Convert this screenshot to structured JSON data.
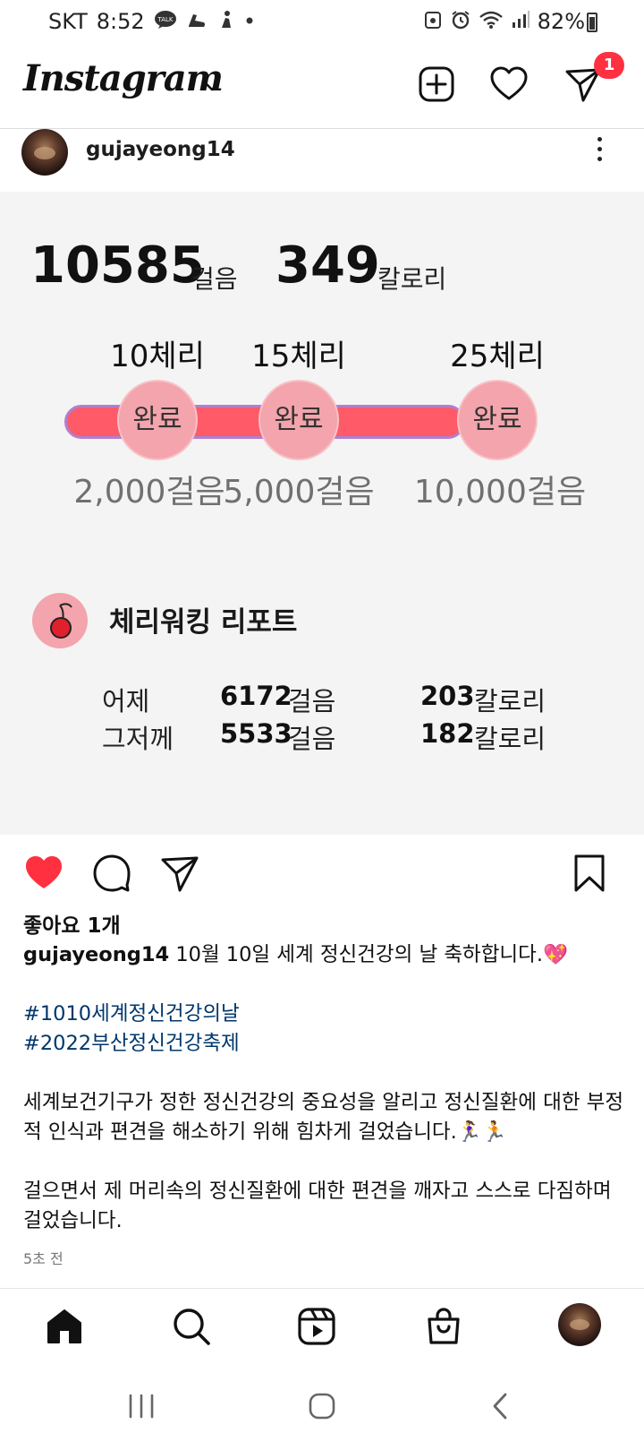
{
  "status_bar": {
    "carrier": "SKT",
    "time": "8:52",
    "talk_badge": "TALK",
    "battery": "82%"
  },
  "header": {
    "logo": "Instagram",
    "notification_count": "1"
  },
  "post": {
    "username": "gujayeong14",
    "image": {
      "steps_value": "10585",
      "steps_unit": "걸음",
      "calories_value": "349",
      "calories_unit": "칼로리",
      "stages": [
        {
          "cherries": "10체리",
          "status": "완료",
          "steps": "2,000걸음"
        },
        {
          "cherries": "15체리",
          "status": "완료",
          "steps": "5,000걸음"
        },
        {
          "cherries": "25체리",
          "status": "완료",
          "steps": "10,000걸음"
        }
      ],
      "report_title": "체리워킹 리포트",
      "report_rows": [
        {
          "day": "어제",
          "steps": "6172",
          "steps_unit": "걸음",
          "calories": "203",
          "calories_unit": "칼로리"
        },
        {
          "day": "그저께",
          "steps": "5533",
          "steps_unit": "걸음",
          "calories": "182",
          "calories_unit": "칼로리"
        }
      ]
    },
    "likes": "좋아요 1개",
    "caption": {
      "username": "gujayeong14",
      "first_line": "10월 10일 세계 정신건강의 날 축하합니다.💖",
      "hashtags": [
        "#1010세계정신건강의날",
        "#2022부산정신건강축제"
      ],
      "paragraph1": "세계보건기구가 정한 정신건강의 중요성을 알리고 정신질환에 대한 부정적 인식과 편견을 해소하기 위해 힘차게 걸었습니다.🏃‍♀️🏃",
      "paragraph2": "걸으면서 제 머리속의 정신질환에 대한 편견을 깨자고 스스로 다짐하며 걸었습니다."
    },
    "time_ago": "5초 전"
  },
  "colors": {
    "like_red": "#ff3040",
    "hashtag_blue": "#00376b",
    "track_red": "#ff5a68",
    "circle_pink": "#f4a4ac"
  },
  "icons": {
    "header": [
      "new-post-icon",
      "heart-icon",
      "direct-message-icon"
    ],
    "actions": [
      "like-heart-icon",
      "comment-icon",
      "share-icon",
      "save-bookmark-icon"
    ],
    "bottom_nav": [
      "home-icon",
      "search-icon",
      "reels-icon",
      "shop-icon",
      "profile-avatar"
    ],
    "system_nav": [
      "recent-apps-icon",
      "home-button-icon",
      "back-icon"
    ]
  }
}
